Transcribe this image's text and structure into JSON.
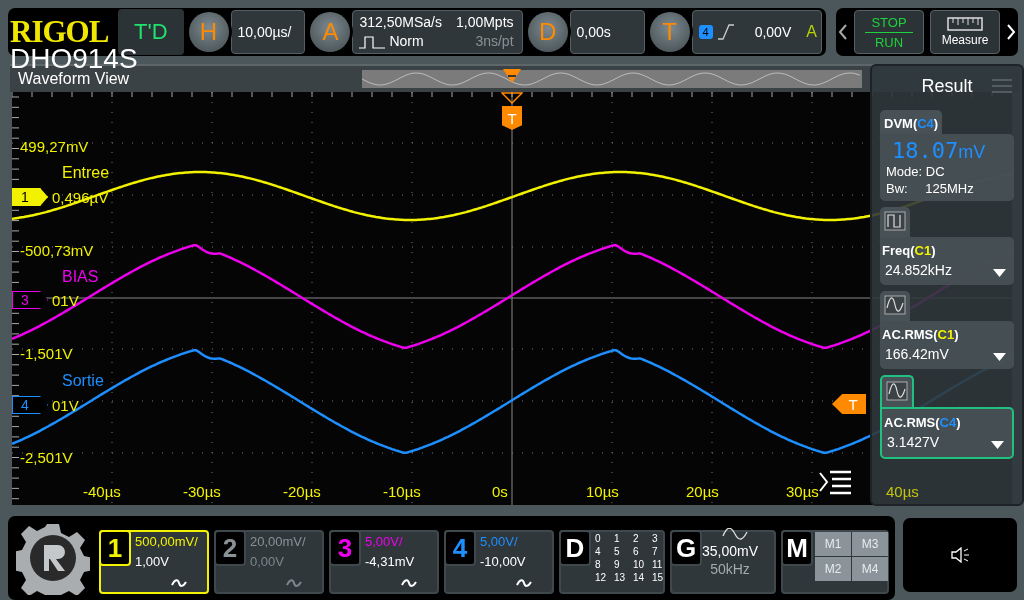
{
  "header": {
    "brand": "RIGOL",
    "model": "DHO914S",
    "mode_button": "T'D"
  },
  "horizontal": {
    "key": "H",
    "scale": "10,00µs/"
  },
  "acquire": {
    "key": "A",
    "sample_rate": "312,50MSa/s",
    "memory_depth": "1,00Mpts",
    "mode": "Norm",
    "resolution": "3ns/pt"
  },
  "delay": {
    "key": "D",
    "value": "0,00s"
  },
  "trigger": {
    "key": "T",
    "source": "4",
    "level": "0,00V",
    "sweep": "A"
  },
  "run_controls": {
    "stop": "STOP",
    "run": "RUN",
    "measure": "Measure"
  },
  "waveform_view": {
    "title": "Waveform View",
    "y_labels": [
      {
        "text": "499,27mV"
      },
      {
        "text": "0,496µV"
      },
      {
        "text": "-500,73mV"
      },
      {
        "text": "01V"
      },
      {
        "text": "-1,501V"
      },
      {
        "text": "01V"
      },
      {
        "text": "-2,501V"
      }
    ],
    "trace_labels": [
      {
        "text": "Entree",
        "color": "#f2f200"
      },
      {
        "text": "BIAS",
        "color": "#ee00ee"
      },
      {
        "text": "Sortie",
        "color": "#1e8fff"
      }
    ],
    "channel_markers": [
      {
        "label": "1",
        "color": "#f2f200",
        "selected": true
      },
      {
        "label": "3",
        "color": "#ee00ee",
        "selected": false
      },
      {
        "label": "4",
        "color": "#1e8fff",
        "selected": false
      }
    ],
    "trigger_markers": [
      {
        "kind": "time",
        "label": "T"
      },
      {
        "kind": "level",
        "label": "T"
      }
    ],
    "x_labels": [
      "-40µs",
      "-30µs",
      "-20µs",
      "-10µs",
      "0s",
      "10µs",
      "20µs",
      "30µs",
      "40µs"
    ]
  },
  "result_panel": {
    "title": "Result",
    "measurements": [
      {
        "kind": "dvm",
        "prefix": "DVM(",
        "source": "C4",
        "suffix": ")",
        "color": "#1e8fff",
        "reading": "18.07",
        "unit": "mV",
        "mode": "Mode: DC",
        "bandwidth_label": "Bw:",
        "bandwidth": "125MHz",
        "selected": false
      },
      {
        "kind": "freq",
        "prefix": "Freq(",
        "source": "C1",
        "suffix": ")",
        "color": "#f2f200",
        "value": "24.852kHz",
        "selected": false
      },
      {
        "kind": "rms",
        "prefix": "AC.RMS(",
        "source": "C1",
        "suffix": ")",
        "color": "#f2f200",
        "value": "166.42mV",
        "selected": false
      },
      {
        "kind": "rms",
        "prefix": "AC.RMS(",
        "source": "C4",
        "suffix": ")",
        "color": "#1e8fff",
        "value": "3.1427V",
        "selected": true
      }
    ]
  },
  "channels": [
    {
      "number": "1",
      "scale": "500,00mV/",
      "offset": "1,00V",
      "color": "#f2f200",
      "selected": true,
      "enabled": true
    },
    {
      "number": "2",
      "scale": "20,00mV/",
      "offset": "0,00V",
      "color": "#8a9296",
      "selected": false,
      "enabled": false
    },
    {
      "number": "3",
      "scale": "5,00V/",
      "offset": "-4,31mV",
      "color": "#ee00ee",
      "selected": false,
      "enabled": true
    },
    {
      "number": "4",
      "scale": "5,00V/",
      "offset": "-10,00V",
      "color": "#1e8fff",
      "selected": false,
      "enabled": true
    }
  ],
  "digital": {
    "key": "D",
    "bits": [
      "0",
      "1",
      "2",
      "3",
      "4",
      "5",
      "6",
      "7",
      "8",
      "9",
      "10",
      "11",
      "12",
      "13",
      "14",
      "15"
    ]
  },
  "generator": {
    "key": "G",
    "amplitude": "35,00mV",
    "frequency": "50kHz"
  },
  "math": {
    "key": "M",
    "slots": [
      "M1",
      "M3",
      "M2",
      "M4"
    ]
  }
}
